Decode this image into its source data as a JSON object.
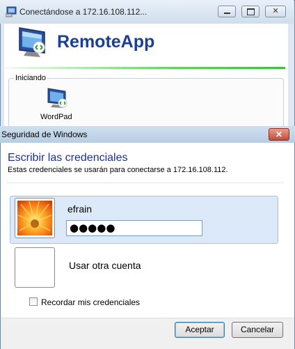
{
  "background_window": {
    "title": "Conectándose a 172.16.108.112...",
    "app_name": "RemoteApp",
    "group_label": "Iniciando",
    "program_name": "WordPad",
    "icons": {
      "title": "remote-desktop-icon",
      "app": "remoteapp-monitor-icon",
      "program": "wordpad-remote-icon"
    },
    "caption_buttons": [
      "minimize",
      "maximize",
      "close"
    ]
  },
  "dialog": {
    "title": "Seguridad de Windows",
    "heading": "Escribir las credenciales",
    "description": "Estas credenciales se usarán para conectarse a 172.16.108.112.",
    "user_tile": {
      "username": "efrain",
      "password_masked": "●●●●●",
      "picture": "orange-flower-user-picture"
    },
    "other_account_label": "Usar otra cuenta",
    "remember_label": "Recordar mis credenciales",
    "remember_checked": false,
    "ok_label": "Aceptar",
    "cancel_label": "Cancelar",
    "close_glyph": "✕"
  },
  "colors": {
    "heading": "#1e3287",
    "app_name": "#1b3f95",
    "progress_green": "#38c238",
    "selected_tile": "#dce9f8",
    "close_button": "#c44b36"
  }
}
